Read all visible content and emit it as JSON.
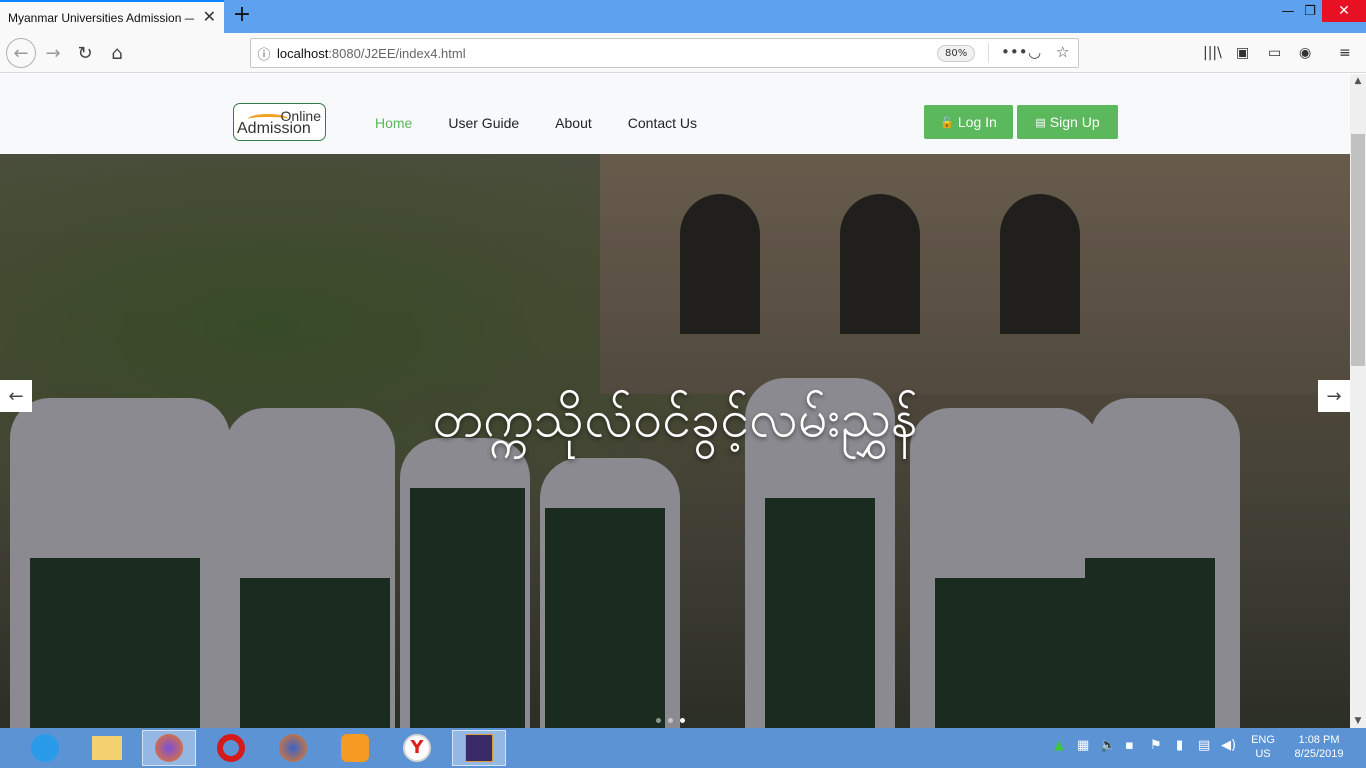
{
  "browser": {
    "tab_title": "Myanmar Universities Admission — W",
    "url_host": "localhost",
    "url_rest": ":8080/J2EE/index4.html",
    "zoom": "80%"
  },
  "site": {
    "logo_online": "Online",
    "logo_admission": "Admission",
    "menu": [
      {
        "label": "Home",
        "active": true
      },
      {
        "label": "User Guide",
        "active": false
      },
      {
        "label": "About",
        "active": false
      },
      {
        "label": "Contact Us",
        "active": false
      }
    ],
    "login_label": "Log In",
    "signup_label": "Sign Up",
    "accent_color": "#5cb85c"
  },
  "hero": {
    "caption": "တက္ကသိုလ်ဝင်ခွင့်လမ်းညွှန်",
    "slide_count": 3,
    "active_slide": 3
  },
  "taskbar": {
    "lang_line1": "ENG",
    "lang_line2": "US",
    "time": "1:08 PM",
    "date": "8/25/2019"
  }
}
